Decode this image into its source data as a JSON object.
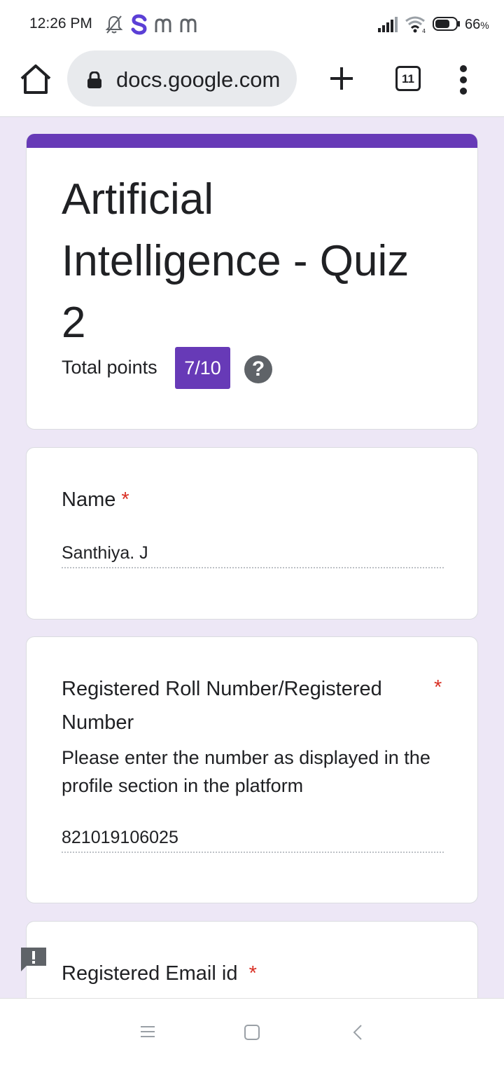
{
  "status_bar": {
    "time": "12:26 PM",
    "notification_icons": [
      "bell-off-icon",
      "s-app-icon",
      "m-app-icon",
      "m-app-icon"
    ],
    "battery_percent": "66",
    "battery_unit": "%"
  },
  "browser": {
    "url": "docs.google.com",
    "tab_count": "11"
  },
  "form": {
    "title": "Artificial Intelligence - Quiz 2",
    "total_points_label": "Total points",
    "score": "7/10",
    "help_symbol": "?",
    "accent_color": "#673ab7"
  },
  "questions": [
    {
      "title": "Name",
      "required_marker": "*",
      "answer": "Santhiya. J"
    },
    {
      "title": "Registered Roll Number/Registered Number",
      "required_marker": "*",
      "description": "Please enter the number as displayed in the profile section in the platform",
      "answer": "821019106025"
    },
    {
      "title": "Registered Email id",
      "required_marker": "*"
    }
  ],
  "report_button": {
    "symbol": "!"
  }
}
